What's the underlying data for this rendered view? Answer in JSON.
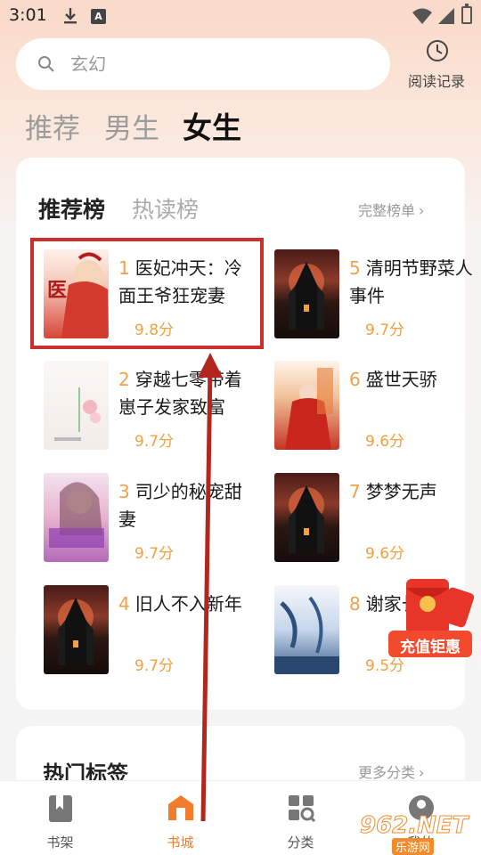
{
  "status_bar": {
    "time": "3:01"
  },
  "search": {
    "placeholder": "玄幻"
  },
  "history": {
    "label": "阅读记录"
  },
  "channel_tabs": [
    {
      "label": "推荐",
      "active": false
    },
    {
      "label": "男生",
      "active": false
    },
    {
      "label": "女生",
      "active": true
    }
  ],
  "ranking": {
    "tabs": [
      {
        "label": "推荐榜",
        "active": true
      },
      {
        "label": "热读榜",
        "active": false
      }
    ],
    "full_list": "完整榜单",
    "books": [
      {
        "rank": "1",
        "title": "医妃冲天：冷面王爷狂宠妻",
        "score": "9.8分",
        "cover": "red"
      },
      {
        "rank": "2",
        "title": "穿越七零带着崽子发家致富",
        "score": "9.7分",
        "cover": "white"
      },
      {
        "rank": "3",
        "title": "司少的秘宠甜妻",
        "score": "9.7分",
        "cover": "pink"
      },
      {
        "rank": "4",
        "title": "旧人不入新年",
        "score": "9.7分",
        "cover": "dark"
      },
      {
        "rank": "5",
        "title": "清明节野菜人事件",
        "score": "9.7分",
        "cover": "dark"
      },
      {
        "rank": "6",
        "title": "盛世天骄",
        "score": "9.6分",
        "cover": "red2"
      },
      {
        "rank": "7",
        "title": "梦梦无声",
        "score": "9.6分",
        "cover": "dark"
      },
      {
        "rank": "8",
        "title": "谢家长命",
        "score": "9.5分",
        "cover": "blue"
      }
    ]
  },
  "recharge_badge": {
    "label": "充值钜惠"
  },
  "tags_section": {
    "title": "热门标签",
    "more": "更多分类"
  },
  "bottom_nav": [
    {
      "label": "书架",
      "icon": "bookshelf-icon",
      "active": false
    },
    {
      "label": "书城",
      "icon": "bookstore-icon",
      "active": true
    },
    {
      "label": "分类",
      "icon": "category-icon",
      "active": false
    },
    {
      "label": "我的",
      "icon": "profile-icon",
      "active": false
    }
  ],
  "watermark": {
    "text": "962.NET",
    "sub": "乐游网"
  },
  "colors": {
    "accent": "#f27c2b",
    "score": "#f0a040",
    "highlight": "#c9302c"
  }
}
